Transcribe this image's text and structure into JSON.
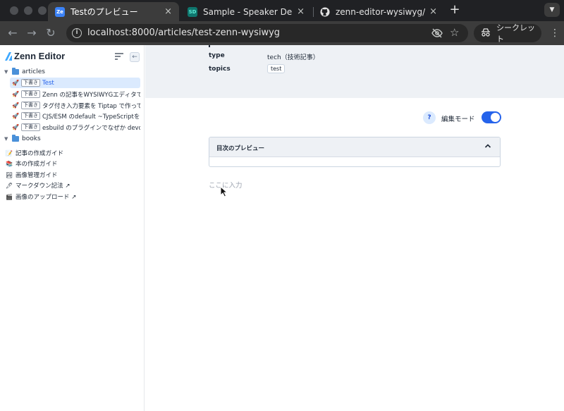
{
  "browser": {
    "tabs": [
      {
        "title": "Testのプレビュー",
        "favicon": "Ze",
        "active": true
      },
      {
        "title": "Sample - Speaker Deck",
        "favicon": "SD",
        "active": false
      },
      {
        "title": "zenn-editor-wysiwyg/packag",
        "favicon": "github-icon",
        "active": false
      }
    ],
    "close_glyph": "×",
    "newtab_glyph": "+",
    "url": "localhost:8000/articles/test-zenn-wysiwyg",
    "incognito_label": "シークレット"
  },
  "sidebar": {
    "brand": "Zenn Editor",
    "articles_folder": "articles",
    "articles": [
      {
        "badge": "下書き",
        "title": "Test",
        "selected": true
      },
      {
        "badge": "下書き",
        "title": "Zenn の記事をWYSIWYGエディタで...",
        "selected": false
      },
      {
        "badge": "下書き",
        "title": "タグ付き入力要素を Tiptap で作って...",
        "selected": false
      },
      {
        "badge": "下書き",
        "title": "CJS/ESM のdefault ~TypeScriptを...",
        "selected": false
      },
      {
        "badge": "下書き",
        "title": "esbuild のプラグインでなぜか devd...",
        "selected": false
      }
    ],
    "books_folder": "books",
    "guides": [
      {
        "label": "記事の作成ガイド",
        "icon": "memo-icon"
      },
      {
        "label": "本の作成ガイド",
        "icon": "books-icon"
      },
      {
        "label": "画像管理ガイド",
        "icon": "picture-icon"
      },
      {
        "label": "マークダウン記法 ↗",
        "icon": "pen-icon"
      },
      {
        "label": "画像のアップロード ↗",
        "icon": "camera-icon"
      }
    ]
  },
  "main": {
    "meta": {
      "type_key": "type",
      "type_value": "tech（技術記事）",
      "topics_key": "topics",
      "topics": [
        "test"
      ]
    },
    "help_label": "?",
    "edit_mode_label": "編集モード",
    "edit_mode_on": true,
    "toc_title": "目次のプレビュー",
    "editor_placeholder": "ここに入力"
  },
  "colors": {
    "accent": "#2563eb",
    "selected_bg": "#dbeafe",
    "meta_bg": "#eef1f5"
  }
}
